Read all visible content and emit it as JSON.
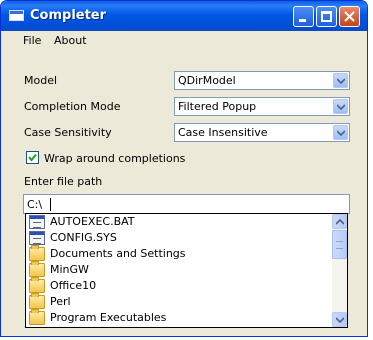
{
  "window": {
    "title": "Completer"
  },
  "menu": {
    "items": [
      "File",
      "About"
    ]
  },
  "form": {
    "model_label": "Model",
    "model_value": "QDirModel",
    "mode_label": "Completion Mode",
    "mode_value": "Filtered Popup",
    "case_label": "Case Sensitivity",
    "case_value": "Case Insensitive",
    "wrap_label": "Wrap around completions",
    "wrap_checked": true,
    "path_label": "Enter file path",
    "path_value": "C:\\"
  },
  "popup": {
    "items": [
      {
        "label": "AUTOEXEC.BAT",
        "icon": "file-icon"
      },
      {
        "label": "CONFIG.SYS",
        "icon": "file-icon"
      },
      {
        "label": "Documents and Settings",
        "icon": "folder-icon"
      },
      {
        "label": "MinGW",
        "icon": "folder-icon"
      },
      {
        "label": "Office10",
        "icon": "folder-icon"
      },
      {
        "label": "Perl",
        "icon": "folder-icon"
      },
      {
        "label": "Program Executables",
        "icon": "folder-icon"
      }
    ]
  },
  "colors": {
    "title_bar": "#0058e6",
    "window_bg": "#ece9d8",
    "close_button": "#c4421d"
  }
}
